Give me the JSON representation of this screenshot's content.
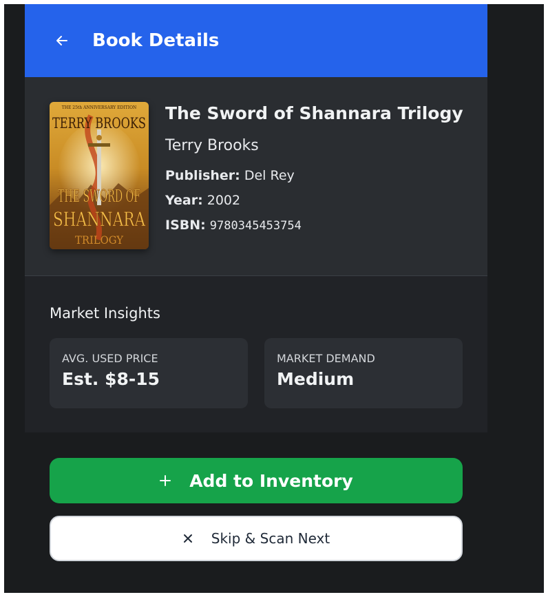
{
  "header": {
    "title": "Book Details",
    "back_icon": "arrow-left-icon"
  },
  "book": {
    "title": "The Sword of Shannara Trilogy",
    "author": "Terry Brooks",
    "publisher_label": "Publisher:",
    "publisher": "Del Rey",
    "year_label": "Year:",
    "year": "2002",
    "isbn_label": "ISBN:",
    "isbn": "9780345453754",
    "cover": {
      "edition_banner": "THE 25th ANNIVERSARY EDITION",
      "author_text": "TERRY BROOKS",
      "title_line1": "THE SWORD OF",
      "title_line2": "SHANNARA",
      "title_line3": "TRILOGY"
    }
  },
  "insights": {
    "heading": "Market Insights",
    "avg_price_label": "AVG. USED PRICE",
    "avg_price_value": "Est. $8-15",
    "demand_label": "MARKET DEMAND",
    "demand_value": "Medium"
  },
  "actions": {
    "add_label": "Add to Inventory",
    "add_icon": "plus-icon",
    "skip_label": "Skip & Scan Next",
    "skip_icon": "close-icon"
  },
  "colors": {
    "appbar": "#2563eb",
    "add_button": "#16a34a",
    "background": "#1a1c1e",
    "card": "#2a2d31"
  }
}
